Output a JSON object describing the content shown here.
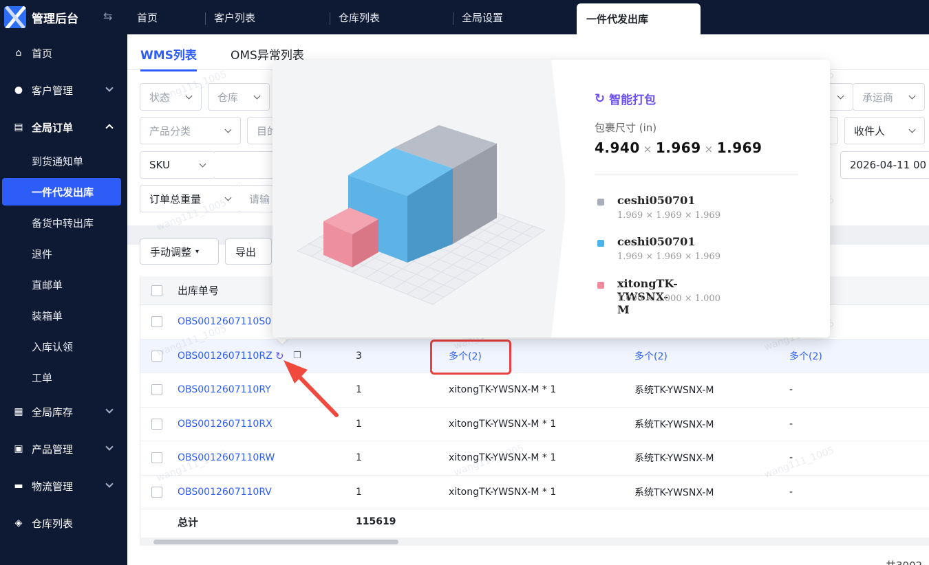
{
  "app": {
    "title": "管理后台"
  },
  "sidebar": {
    "items": [
      {
        "label": "首页",
        "icon": "home-icon"
      },
      {
        "label": "客户管理",
        "icon": "users-icon"
      },
      {
        "label": "全局订单",
        "icon": "orders-icon"
      },
      {
        "label": "全局库存",
        "icon": "inventory-icon"
      },
      {
        "label": "产品管理",
        "icon": "product-icon"
      },
      {
        "label": "物流管理",
        "icon": "truck-icon"
      },
      {
        "label": "仓库列表",
        "icon": "warehouse-icon"
      }
    ],
    "order_sub": [
      "到货通知单",
      "一件代发出库",
      "备货中转出库",
      "退件",
      "直邮单",
      "装箱单",
      "入库认领",
      "工单"
    ]
  },
  "tabs": [
    "首页",
    "客户列表",
    "仓库列表",
    "全局设置",
    "一件代发出库"
  ],
  "subtabs": [
    "WMS列表",
    "OMS异常列表"
  ],
  "filters": {
    "status": "状态",
    "warehouse": "仓库",
    "carrier": "承运商",
    "category": "产品分类",
    "dest": "目的",
    "receiver": "收件人",
    "sku": "SKU",
    "date": "2026-04-11 00",
    "weight": "订单总重量",
    "input_placeholder": "请输"
  },
  "toolbar": {
    "adjust": "手动调整",
    "export": "导出"
  },
  "table": {
    "col_order_no": "出库单号",
    "rows": [
      {
        "id": "OBS0012607110S0",
        "qty": "",
        "c3": "",
        "c4": "",
        "c5": ""
      },
      {
        "id": "OBS0012607110RZ",
        "qty": "3",
        "c3": "多个(2)",
        "c4": "多个(2)",
        "c5": "多个(2)"
      },
      {
        "id": "OBS0012607110RY",
        "qty": "1",
        "c3": "xitongTK-YWSNX-M * 1",
        "c4": "系统TK-YWSNX-M",
        "c5": "-"
      },
      {
        "id": "OBS0012607110RX",
        "qty": "1",
        "c3": "xitongTK-YWSNX-M * 1",
        "c4": "系统TK-YWSNX-M",
        "c5": "-"
      },
      {
        "id": "OBS0012607110RW",
        "qty": "1",
        "c3": "xitongTK-YWSNX-M * 1",
        "c4": "系统TK-YWSNX-M",
        "c5": "-"
      },
      {
        "id": "OBS0012607110RV",
        "qty": "1",
        "c3": "xitongTK-YWSNX-M * 1",
        "c4": "系统TK-YWSNX-M",
        "c5": "-"
      }
    ],
    "total_label": "总计",
    "total_value": "115619"
  },
  "footer": {
    "page_text": "共3002"
  },
  "popover": {
    "title": "智能打包",
    "size_label": "包裹尺寸 (in)",
    "dims": [
      "4.940",
      "1.969",
      "1.969"
    ],
    "sep": "×",
    "items": [
      {
        "name": "ceshi050701",
        "dims": "1.969 × 1.969 × 1.969",
        "color": "#a9aebb"
      },
      {
        "name": "ceshi050701",
        "dims": "1.969 × 1.969 × 1.969",
        "color": "#4bb3ee"
      },
      {
        "name": "xitongTK-YWSNX-M",
        "dims": "1.000 × 1.000 × 1.000",
        "color": "#ef8a9c"
      }
    ]
  },
  "watermark": "wang111_1005",
  "colors": {
    "primary": "#2d5cf6",
    "sidebar": "#0e1934",
    "highlight": "#e94040"
  }
}
